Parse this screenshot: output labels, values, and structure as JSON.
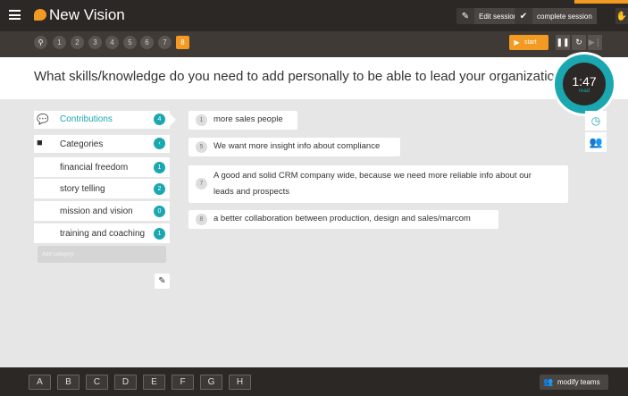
{
  "app": {
    "title": "New Vision"
  },
  "header": {
    "edit_session": "Edit session",
    "complete_session": "complete session"
  },
  "steps": [
    "1",
    "2",
    "3",
    "4",
    "5",
    "6",
    "7",
    "8"
  ],
  "controls": {
    "start": "start"
  },
  "question": "What skills/knowledge do you need to add personally to be able to lead your organization?",
  "timer": {
    "time": "1:47",
    "label": "read"
  },
  "sidebar": {
    "contributions": {
      "label": "Contributions",
      "count": "4"
    },
    "categories": {
      "label": "Categories"
    },
    "category_items": [
      {
        "label": "financial freedom",
        "count": "1"
      },
      {
        "label": "story telling",
        "count": "2"
      },
      {
        "label": "mission and vision",
        "count": "0"
      },
      {
        "label": "training and coaching",
        "count": "1"
      }
    ],
    "add_category_placeholder": "Add category"
  },
  "contributions": [
    {
      "num": "1",
      "text": "more sales people"
    },
    {
      "num": "5",
      "text": "We want more insight info about compliance"
    },
    {
      "num": "7",
      "text": "A good and solid CRM company wide, because we need more reliable info about our",
      "text2": "leads and prospects"
    },
    {
      "num": "8",
      "text": "a better collaboration between production, design and sales/marcom"
    }
  ],
  "teams": [
    "A",
    "B",
    "C",
    "D",
    "E",
    "F",
    "G",
    "H"
  ],
  "footer": {
    "modify_teams": "modify teams"
  },
  "colors": {
    "accent": "#f39a22",
    "teal": "#1aa7b0",
    "dark": "#2c2826"
  },
  "icons": [
    "menu-icon",
    "logo-bubble-icon",
    "pencil-icon",
    "check-icon",
    "hand-icon",
    "pin-icon",
    "play-icon",
    "pause-icon",
    "reset-icon",
    "skip-icon",
    "chat-bubble-icon",
    "folder-icon",
    "clock-icon",
    "users-icon"
  ]
}
